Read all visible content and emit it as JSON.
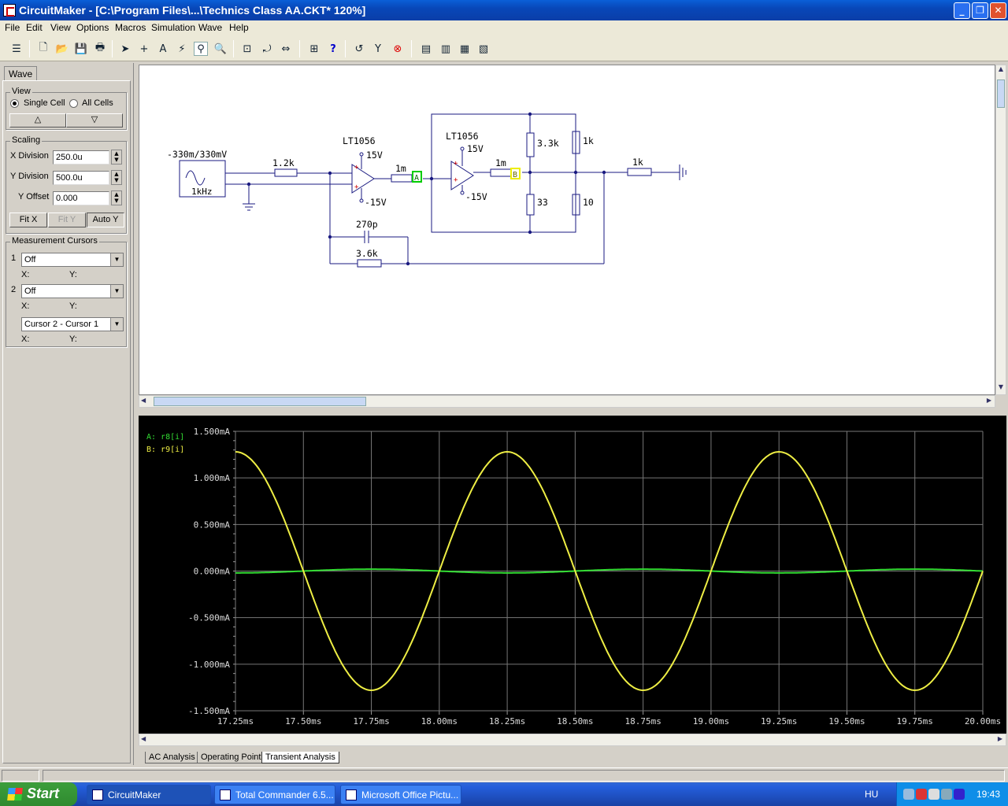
{
  "window": {
    "title": "CircuitMaker - [C:\\Program Files\\...\\Technics Class AA.CKT* 120%]"
  },
  "menu": [
    "File",
    "Edit",
    "View",
    "Options",
    "Macros",
    "Simulation",
    "Wave",
    "Help"
  ],
  "panel": {
    "tab": "Wave",
    "view_group": "View",
    "single_cell": "Single Cell",
    "all_cells": "All Cells",
    "up_arrow": "△",
    "down_arrow": "▽",
    "scaling_group": "Scaling",
    "x_division_label": "X Division",
    "x_division_value": "250.0u",
    "y_division_label": "Y Division",
    "y_division_value": "500.0u",
    "y_offset_label": "Y Offset",
    "y_offset_value": "0.000",
    "fit_x": "Fit X",
    "fit_y": "Fit Y",
    "auto_y": "Auto Y",
    "cursors_group": "Measurement Cursors",
    "cursor1_num": "1",
    "cursor1_value": "Off",
    "cursor2_num": "2",
    "cursor2_value": "Off",
    "cursor_diff_value": "Cursor 2 - Cursor 1",
    "x_label": "X:",
    "y_label": "Y:"
  },
  "schematic": {
    "source_label": "-330m/330mV",
    "source_freq": "1kHz",
    "r_input": "1.2k",
    "opamp1_name": "LT1056",
    "opamp1_vpos": "15V",
    "opamp1_vneg": "-15V",
    "r_1m_a": "1m",
    "probe_a": "A",
    "opamp2_name": "LT1056",
    "opamp2_vpos": "15V",
    "opamp2_vneg": "-15V",
    "r_1m_b": "1m",
    "probe_b": "B",
    "r_33k": "3.3k",
    "r_33": "33",
    "r_1k_top": "1k",
    "r_10": "10",
    "r_1k_out": "1k",
    "c_feedback": "270p",
    "r_feedback": "3.6k"
  },
  "chart_data": {
    "type": "line",
    "legend": [
      {
        "label": "A: r8[i]",
        "color": "#33dd33"
      },
      {
        "label": "B: r9[i]",
        "color": "#eeee44"
      }
    ],
    "x_ticks": [
      "17.25ms",
      "17.50ms",
      "17.75ms",
      "18.00ms",
      "18.25ms",
      "18.50ms",
      "18.75ms",
      "19.00ms",
      "19.25ms",
      "19.50ms",
      "19.75ms",
      "20.00ms"
    ],
    "y_ticks": [
      "1.500mA",
      "1.000mA",
      "0.500mA",
      "0.000mA",
      "-0.500mA",
      "-1.000mA",
      "-1.500mA"
    ],
    "xlim_ms": [
      17.25,
      20.0
    ],
    "ylim_mA": [
      -1.5,
      1.5
    ],
    "series": [
      {
        "name": "A: r8[i]",
        "color": "#33dd33",
        "amplitude_mA": 0.02,
        "frequency_kHz": 1,
        "zero_crossing_ms": 17.5
      },
      {
        "name": "B: r9[i]",
        "color": "#eeee44",
        "amplitude_mA": 1.28,
        "frequency_kHz": 1,
        "zero_crossing_ms": 17.5
      }
    ],
    "grid": true
  },
  "analysis_tabs": [
    "AC Analysis",
    "Operating Point",
    "Transient Analysis"
  ],
  "taskbar": {
    "start": "Start",
    "tasks": [
      "CircuitMaker",
      "Total Commander 6.5...",
      "Microsoft Office Pictu..."
    ],
    "lang": "HU",
    "clock": "19:43"
  }
}
